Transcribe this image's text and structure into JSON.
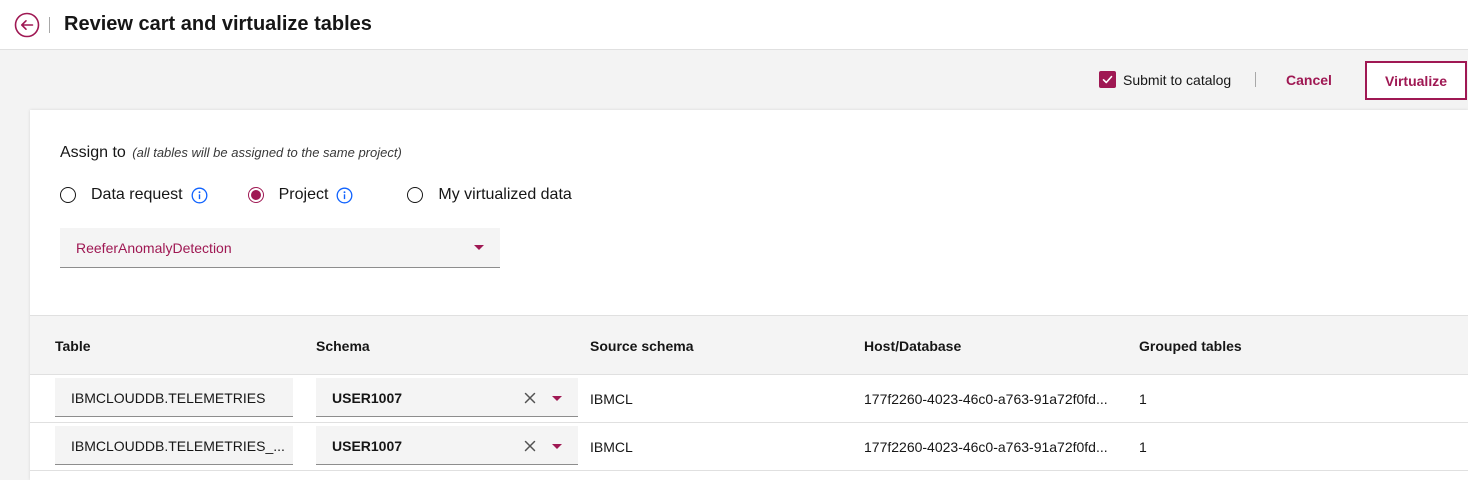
{
  "header": {
    "title": "Review cart and virtualize tables",
    "back_icon": "arrow-left-circle-icon"
  },
  "toolbar": {
    "submit_label": "Submit to catalog",
    "submit_checked": true,
    "cancel_label": "Cancel",
    "virtualize_label": "Virtualize"
  },
  "assign": {
    "label": "Assign to",
    "note": "(all tables will be assigned to the same project)",
    "options": [
      {
        "label": "Data request",
        "checked": false,
        "info": true
      },
      {
        "label": "Project",
        "checked": true,
        "info": true
      },
      {
        "label": "My virtualized data",
        "checked": false,
        "info": false
      }
    ],
    "project_value": "ReeferAnomalyDetection"
  },
  "table": {
    "columns": [
      "Table",
      "Schema",
      "Source schema",
      "Host/Database",
      "Grouped tables"
    ],
    "rows": [
      {
        "table": "IBMCLOUDDB.TELEMETRIES",
        "schema": "USER1007",
        "source_schema": "IBMCL",
        "host": "177f2260-4023-46c0-a763-91a72f0fd...",
        "grouped": "1"
      },
      {
        "table": "IBMCLOUDDB.TELEMETRIES_...",
        "schema": "USER1007",
        "source_schema": "IBMCL",
        "host": "177f2260-4023-46c0-a763-91a72f0fd...",
        "grouped": "1"
      }
    ]
  },
  "colors": {
    "accent": "#9f1853",
    "info": "#0f62fe"
  }
}
